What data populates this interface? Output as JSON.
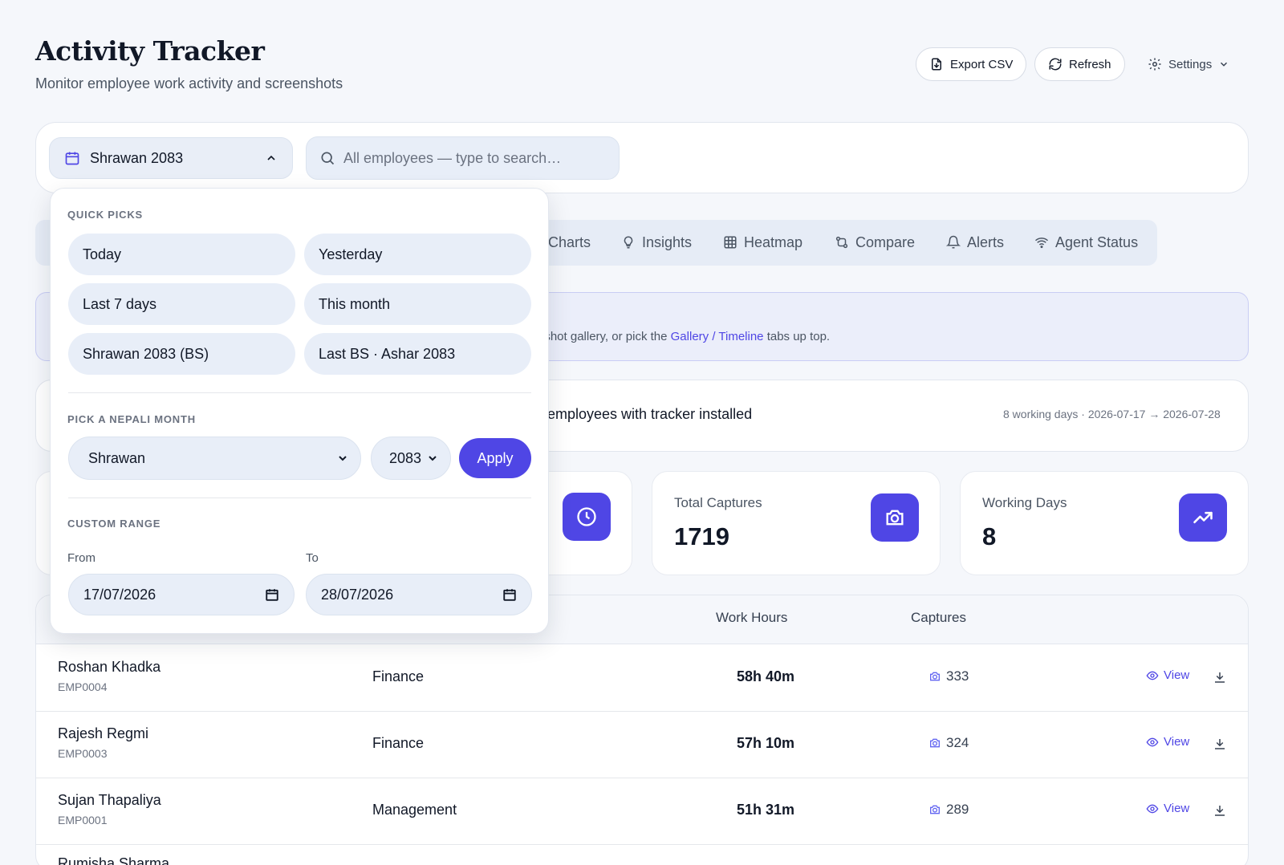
{
  "header": {
    "title": "Activity Tracker",
    "subtitle": "Monitor employee work activity and screenshots"
  },
  "actions": {
    "export": "Export CSV",
    "refresh": "Refresh",
    "settings": "Settings"
  },
  "filters": {
    "month": "Shrawan 2083",
    "search_placeholder": "All employees — type to search…"
  },
  "tabs": [
    {
      "label": "Charts",
      "icon": "chart-icon"
    },
    {
      "label": "Insights",
      "icon": "lightbulb-icon"
    },
    {
      "label": "Heatmap",
      "icon": "grid-icon"
    },
    {
      "label": "Compare",
      "icon": "compare-icon"
    },
    {
      "label": "Alerts",
      "icon": "bell-icon"
    },
    {
      "label": "Agent Status",
      "icon": "wifi-icon"
    }
  ],
  "banner": {
    "text_before": "nshot gallery, or pick the ",
    "gallery": "Gallery",
    "sep": " / ",
    "timeline": "Timeline",
    "text_after": " tabs up top."
  },
  "info": {
    "text": "employees with tracker installed",
    "right": "8 working days · 2026-07-17 → 2026-07-28"
  },
  "stats": [
    {
      "label": "Total Captures",
      "value": "1719",
      "icon": "camera-icon"
    },
    {
      "label": "Working Days",
      "value": "8",
      "icon": "trending-up-icon"
    }
  ],
  "table": {
    "headers": {
      "hours": "Work Hours",
      "captures": "Captures"
    },
    "view_label": "View",
    "rows": [
      {
        "name": "Roshan Khadka",
        "code": "EMP0004",
        "dept": "Finance",
        "hours": "58h 40m",
        "captures": "333"
      },
      {
        "name": "Rajesh Regmi",
        "code": "EMP0003",
        "dept": "Finance",
        "hours": "57h 10m",
        "captures": "324"
      },
      {
        "name": "Sujan Thapaliya",
        "code": "EMP0001",
        "dept": "Management",
        "hours": "51h 31m",
        "captures": "289"
      },
      {
        "name": "Rumisha Sharma"
      }
    ]
  },
  "dropdown": {
    "quick_picks_label": "QUICK PICKS",
    "quick_picks": [
      "Today",
      "Yesterday",
      "Last 7 days",
      "This month",
      "Shrawan 2083 (BS)",
      "Last BS · Ashar 2083"
    ],
    "nepali_label": "PICK A NEPALI MONTH",
    "month_value": "Shrawan",
    "year_value": "2083",
    "apply": "Apply",
    "custom_label": "CUSTOM RANGE",
    "from_label": "From",
    "to_label": "To",
    "from_value": "17/07/2026",
    "to_value": "28/07/2026"
  },
  "colors": {
    "accent": "#4f46e5",
    "background": "#f5f7fb"
  }
}
